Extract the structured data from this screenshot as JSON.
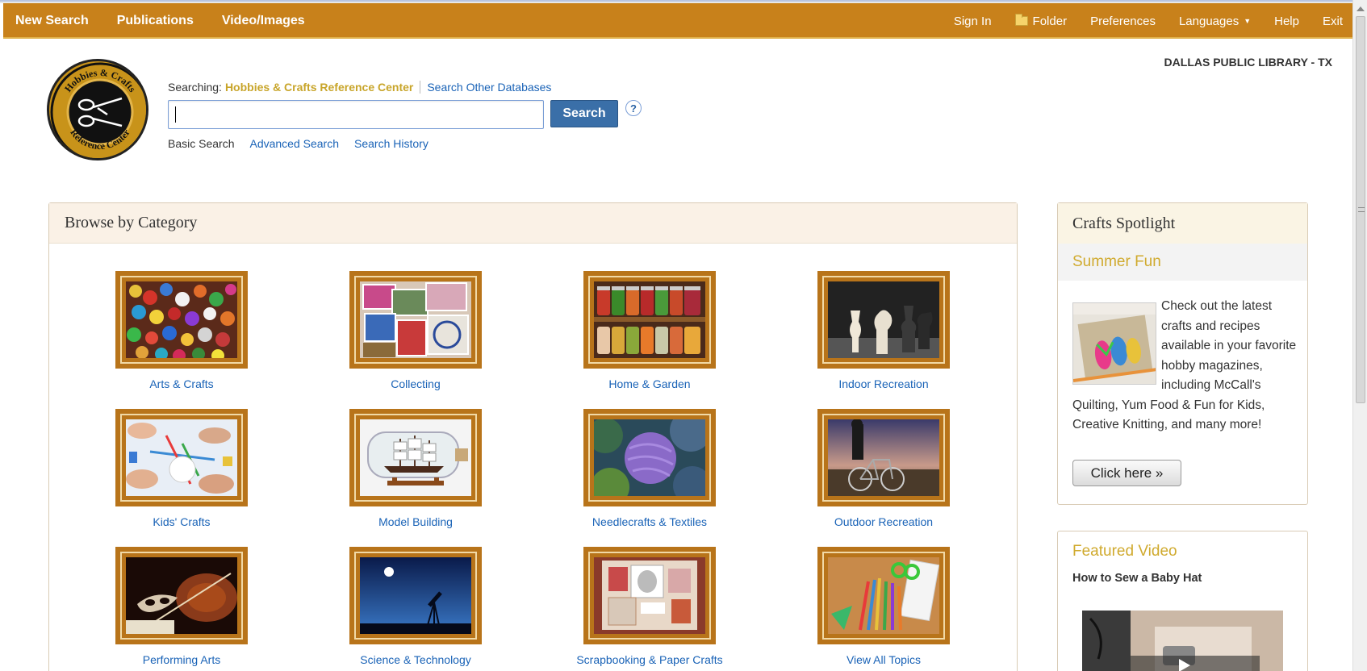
{
  "nav": {
    "left": [
      "New Search",
      "Publications",
      "Video/Images"
    ],
    "sign_in": "Sign In",
    "folder": "Folder",
    "preferences": "Preferences",
    "languages": "Languages",
    "help": "Help",
    "exit": "Exit"
  },
  "search": {
    "searching_label": "Searching:",
    "database": "Hobbies & Crafts Reference Center",
    "other_databases": "Search Other Databases",
    "query": "",
    "button": "Search",
    "help": "?",
    "modes": [
      "Basic Search",
      "Advanced Search",
      "Search History"
    ]
  },
  "library": "DALLAS PUBLIC LIBRARY - TX",
  "browse": {
    "title": "Browse by Category",
    "categories": [
      "Arts & Crafts",
      "Collecting",
      "Home & Garden",
      "Indoor Recreation",
      "Kids' Crafts",
      "Model Building",
      "Needlecrafts & Textiles",
      "Outdoor Recreation",
      "Performing Arts",
      "Science & Technology",
      "Scrapbooking & Paper Crafts",
      "View All Topics"
    ]
  },
  "spotlight": {
    "title": "Crafts Spotlight",
    "subtitle": "Summer Fun",
    "text": "Check out the latest crafts and recipes available in your favorite hobby magazines, including McCall's Quilting, Yum Food & Fun for Kids, Creative Knitting, and many more!",
    "button": "Click here »"
  },
  "video": {
    "title": "Featured Video",
    "name": "How to Sew a Baby Hat"
  },
  "colors": {
    "nav_bg": "#c8811b",
    "frame": "#b8741a",
    "link": "#1a63b7",
    "gold": "#d0aa2e",
    "search_button": "#3a6fa8"
  }
}
